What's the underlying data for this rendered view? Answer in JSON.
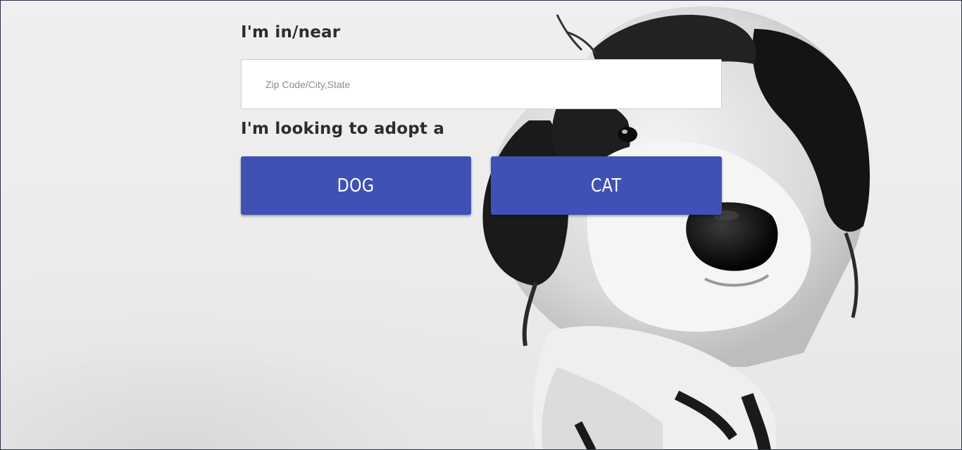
{
  "form": {
    "location_label": "I'm in/near",
    "location_placeholder": "Zip Code/City,State",
    "location_value": "",
    "adopt_label": "I'm looking to adopt a",
    "dog_button_label": "DOG",
    "cat_button_label": "CAT"
  },
  "background": {
    "image": "black-and-white-dog-photo"
  },
  "colors": {
    "button_bg": "#3f51b5",
    "button_text": "#ffffff",
    "label_text": "#2d2d2d",
    "page_bg": "#eeeeef"
  }
}
